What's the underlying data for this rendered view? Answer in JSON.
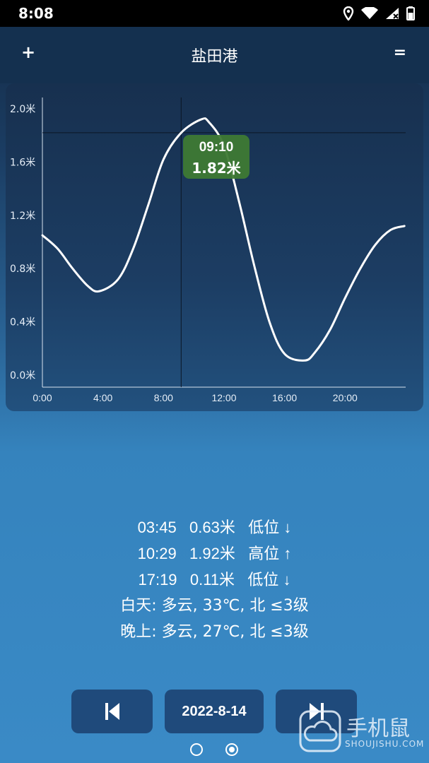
{
  "status_bar": {
    "time": "8:08"
  },
  "app_bar": {
    "add_label": "+",
    "title": "盐田港",
    "menu_label": "="
  },
  "chart_data": {
    "type": "line",
    "y_ticks": [
      "2.0米",
      "1.6米",
      "1.2米",
      "0.8米",
      "0.4米",
      "0.0米"
    ],
    "x_ticks": [
      "0:00",
      "4:00",
      "8:00",
      "12:00",
      "16:00",
      "20:00"
    ],
    "ylim": [
      0,
      2.0
    ],
    "xlim_hours": [
      0,
      24
    ],
    "series": [
      {
        "x": [
          "0:00",
          "1:00",
          "2:00",
          "3:00",
          "3:45",
          "5:00",
          "6:00",
          "7:00",
          "8:00",
          "9:10",
          "10:29",
          "11:00",
          "12:00",
          "13:00",
          "14:00",
          "15:00",
          "16:00",
          "17:19",
          "18:00",
          "19:00",
          "20:00",
          "21:00",
          "22:00",
          "23:00",
          "23:55"
        ],
        "y": [
          1.05,
          0.95,
          0.8,
          0.67,
          0.63,
          0.72,
          0.95,
          1.28,
          1.62,
          1.82,
          1.92,
          1.9,
          1.72,
          1.3,
          0.82,
          0.4,
          0.16,
          0.11,
          0.17,
          0.34,
          0.58,
          0.8,
          0.98,
          1.09,
          1.12
        ]
      }
    ],
    "cursor": {
      "time": "09:10",
      "value": "1.82米"
    },
    "grid": false
  },
  "tides": [
    {
      "text": "03:45   0.63米   低位 ↓"
    },
    {
      "text": "10:29   1.92米   高位 ↑"
    },
    {
      "text": "17:19   0.11米   低位 ↓"
    }
  ],
  "weather": {
    "day": "白天: 多云, 33℃, 北 ≤3级",
    "night": "晚上: 多云, 27℃, 北 ≤3级"
  },
  "nav": {
    "date": "2022-8-14"
  },
  "watermark": {
    "text": "手机鼠",
    "sub": "SHOUJISHU.COM"
  }
}
